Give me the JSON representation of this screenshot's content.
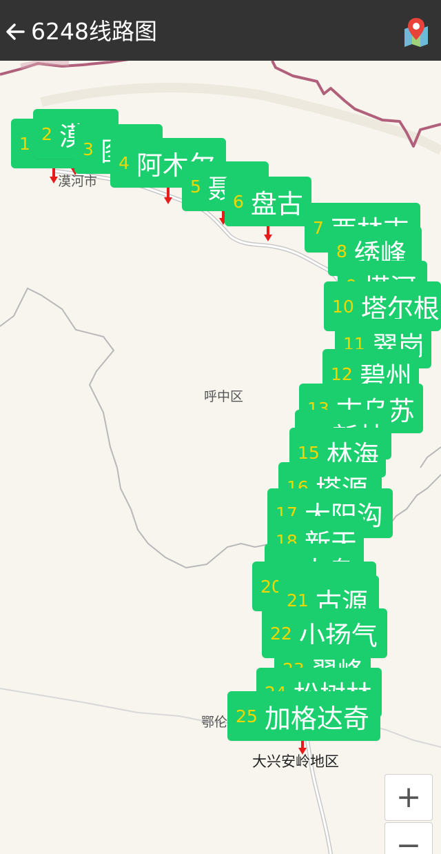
{
  "header": {
    "title": "6248线路图",
    "back_icon": "arrow-left-icon",
    "map_icon": "map-pin-icon"
  },
  "map": {
    "labels": {
      "mohe": "漠河市",
      "huzhong": "呼中区",
      "elun": "鄂伦",
      "daxinganling": "大兴安岭地区"
    },
    "zoom_in": "+",
    "zoom_out": "−"
  },
  "stops": [
    {
      "num": "1",
      "name": "漠"
    },
    {
      "num": "2",
      "name": "漠"
    },
    {
      "num": "3",
      "name": "图"
    },
    {
      "num": "4",
      "name": "阿木尔"
    },
    {
      "num": "5",
      "name": "聂"
    },
    {
      "num": "6",
      "name": "盘古"
    },
    {
      "num": "7",
      "name": "西林吉"
    },
    {
      "num": "8",
      "name": "绣峰"
    },
    {
      "num": "9",
      "name": "塔河"
    },
    {
      "num": "10",
      "name": "塔尔根"
    },
    {
      "num": "11",
      "name": "翠岗"
    },
    {
      "num": "12",
      "name": "碧州"
    },
    {
      "num": "13",
      "name": "古乌苏"
    },
    {
      "num": "14",
      "name": "新林"
    },
    {
      "num": "15",
      "name": "林海"
    },
    {
      "num": "16",
      "name": "塔源"
    },
    {
      "num": "17",
      "name": "大阳沟"
    },
    {
      "num": "18",
      "name": "新天"
    },
    {
      "num": "19",
      "name": "大乌"
    },
    {
      "num": "20",
      "name": ""
    },
    {
      "num": "21",
      "name": "古源"
    },
    {
      "num": "22",
      "name": "小扬气"
    },
    {
      "num": "23",
      "name": "翠峰"
    },
    {
      "num": "24",
      "name": "松树林"
    },
    {
      "num": "25",
      "name": "加格达奇"
    }
  ],
  "colors": {
    "topbar": "#333333",
    "stop_bg": "#1ccf6e",
    "stop_num": "#f2d600",
    "border": "#b0607a",
    "marker": "#e81b1b"
  }
}
